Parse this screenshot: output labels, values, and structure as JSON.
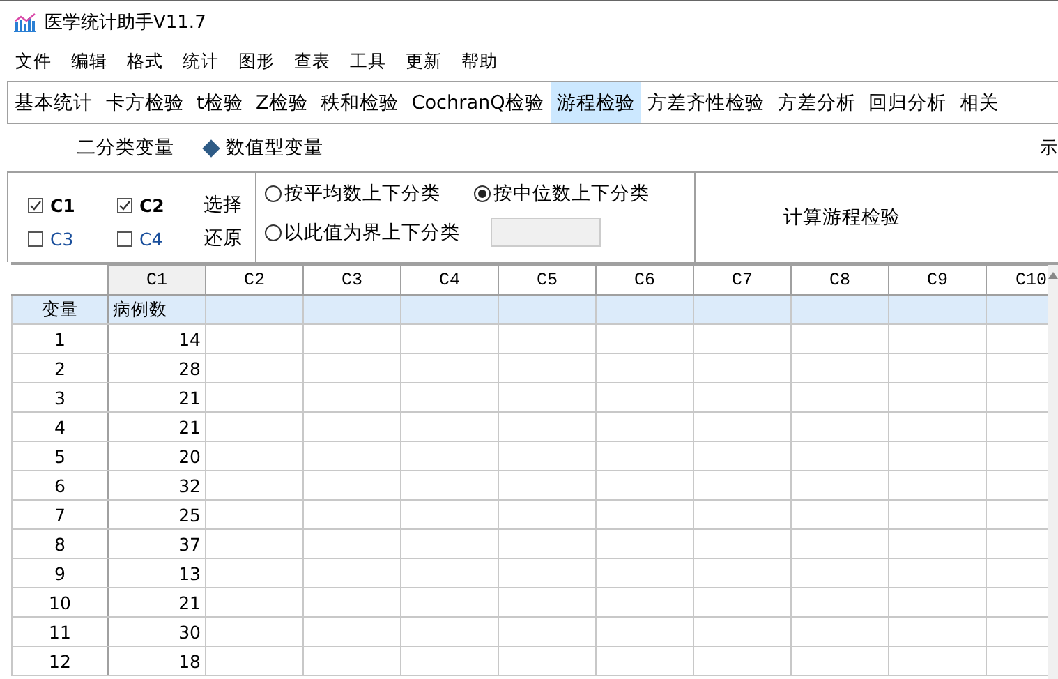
{
  "window": {
    "title": "医学统计助手V11.7"
  },
  "menu": [
    "文件",
    "编辑",
    "格式",
    "统计",
    "图形",
    "查表",
    "工具",
    "更新",
    "帮助"
  ],
  "tabs": [
    {
      "label": "基本统计",
      "selected": false
    },
    {
      "label": "卡方检验",
      "selected": false
    },
    {
      "label": "t检验",
      "selected": false
    },
    {
      "label": "Z检验",
      "selected": false
    },
    {
      "label": "秩和检验",
      "selected": false
    },
    {
      "label": "CochranQ检验",
      "selected": false
    },
    {
      "label": "游程检验",
      "selected": true
    },
    {
      "label": "方差齐性检验",
      "selected": false
    },
    {
      "label": "方差分析",
      "selected": false
    },
    {
      "label": "回归分析",
      "selected": false
    },
    {
      "label": "相关",
      "selected": false
    }
  ],
  "variable_types": [
    {
      "label": "二分类变量",
      "selected": false
    },
    {
      "label": "数值型变量",
      "selected": true
    }
  ],
  "example_link": "示",
  "columns_select": [
    {
      "label": "C1",
      "checked": true
    },
    {
      "label": "C2",
      "checked": true
    },
    {
      "label": "C3",
      "checked": false
    },
    {
      "label": "C4",
      "checked": false
    }
  ],
  "select_buttons": [
    "选择",
    "还原"
  ],
  "split_options": [
    {
      "label": "按平均数上下分类",
      "selected": false
    },
    {
      "label": "按中位数上下分类",
      "selected": true
    },
    {
      "label": "以此值为界上下分类",
      "selected": false
    }
  ],
  "run_button": "计算游程检验",
  "grid": {
    "columns": [
      {
        "label": "C1",
        "selected": true
      },
      {
        "label": "C2",
        "selected": false
      },
      {
        "label": "C3",
        "selected": false
      },
      {
        "label": "C4",
        "selected": false
      },
      {
        "label": "C5",
        "selected": false
      },
      {
        "label": "C6",
        "selected": false
      },
      {
        "label": "C7",
        "selected": false
      },
      {
        "label": "C8",
        "selected": false
      },
      {
        "label": "C9",
        "selected": false
      },
      {
        "label": "C10",
        "selected": false
      }
    ],
    "name_row_label": "变量",
    "names": [
      "病例数"
    ],
    "rows": [
      {
        "label": "1",
        "values": [
          "14"
        ]
      },
      {
        "label": "2",
        "values": [
          "28"
        ]
      },
      {
        "label": "3",
        "values": [
          "21"
        ]
      },
      {
        "label": "4",
        "values": [
          "21"
        ]
      },
      {
        "label": "5",
        "values": [
          "20"
        ]
      },
      {
        "label": "6",
        "values": [
          "32"
        ]
      },
      {
        "label": "7",
        "values": [
          "25"
        ]
      },
      {
        "label": "8",
        "values": [
          "37"
        ]
      },
      {
        "label": "9",
        "values": [
          "13"
        ]
      },
      {
        "label": "10",
        "values": [
          "21"
        ]
      },
      {
        "label": "11",
        "values": [
          "30"
        ]
      },
      {
        "label": "12",
        "values": [
          "18"
        ]
      }
    ]
  }
}
